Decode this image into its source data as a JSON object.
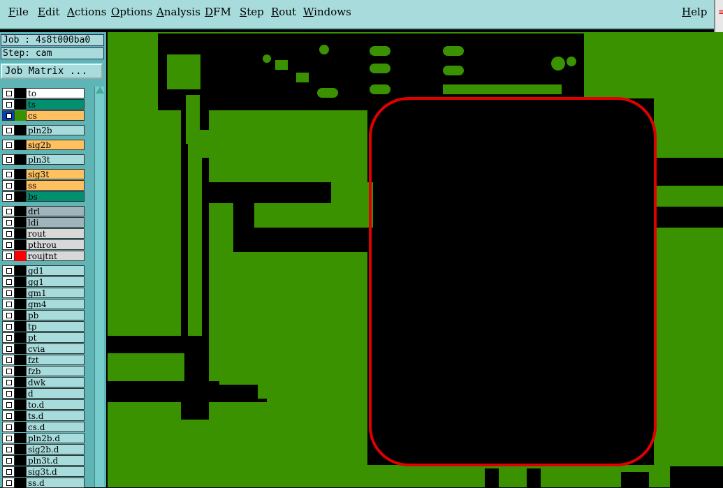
{
  "menubar": {
    "items": [
      "File",
      "Edit",
      "Actions",
      "Options",
      "Analysis",
      "DFM",
      "Step",
      "Rout",
      "Windows"
    ],
    "help": "Help"
  },
  "panel": {
    "job": "Job : 4s8t000ba0",
    "step": "Step: cam",
    "job_matrix": "Job Matrix ..."
  },
  "layers": [
    {
      "name": "to",
      "color": "#ffffff",
      "swatch": "#000000"
    },
    {
      "name": "ts",
      "color": "#009070",
      "swatch": "#000000"
    },
    {
      "name": "cs",
      "color": "#ffc060",
      "swatch": "#3a9200",
      "active": true
    },
    {
      "name": "pln2b",
      "color": "#a8dcdc",
      "swatch": "#000000"
    },
    {
      "name": "sig2b",
      "color": "#ffc060",
      "swatch": "#000000"
    },
    {
      "name": "pln3t",
      "color": "#a8dcdc",
      "swatch": "#000000"
    },
    {
      "name": "sig3t",
      "color": "#ffc060",
      "swatch": "#000000"
    },
    {
      "name": "ss",
      "color": "#ffc060",
      "swatch": "#000000"
    },
    {
      "name": "bs",
      "color": "#009070",
      "swatch": "#000000"
    },
    {
      "name": "drl",
      "color": "#a0b4bc",
      "swatch": "#000000"
    },
    {
      "name": "ldi",
      "color": "#a0b4bc",
      "swatch": "#000000"
    },
    {
      "name": "rout",
      "color": "#d8d8d8",
      "swatch": "#000000"
    },
    {
      "name": "pthrou",
      "color": "#d8d8d8",
      "swatch": "#000000"
    },
    {
      "name": "roujtnt",
      "color": "#d8d8d8",
      "swatch": "#ff0000"
    },
    {
      "name": "gd1",
      "color": "#a8dcdc",
      "swatch": "#000000"
    },
    {
      "name": "gg1",
      "color": "#a8dcdc",
      "swatch": "#000000"
    },
    {
      "name": "gm1",
      "color": "#a8dcdc",
      "swatch": "#000000"
    },
    {
      "name": "gm4",
      "color": "#a8dcdc",
      "swatch": "#000000"
    },
    {
      "name": "pb",
      "color": "#a8dcdc",
      "swatch": "#000000"
    },
    {
      "name": "tp",
      "color": "#a8dcdc",
      "swatch": "#000000"
    },
    {
      "name": "pt",
      "color": "#a8dcdc",
      "swatch": "#000000"
    },
    {
      "name": "cvia",
      "color": "#a8dcdc",
      "swatch": "#000000"
    },
    {
      "name": "fzt",
      "color": "#a8dcdc",
      "swatch": "#000000"
    },
    {
      "name": "fzb",
      "color": "#a8dcdc",
      "swatch": "#000000"
    },
    {
      "name": "dwk",
      "color": "#a8dcdc",
      "swatch": "#000000"
    },
    {
      "name": "d",
      "color": "#a8dcdc",
      "swatch": "#000000"
    },
    {
      "name": "to.d",
      "color": "#a8dcdc",
      "swatch": "#000000"
    },
    {
      "name": "ts.d",
      "color": "#a8dcdc",
      "swatch": "#000000"
    },
    {
      "name": "cs.d",
      "color": "#a8dcdc",
      "swatch": "#000000"
    },
    {
      "name": "pln2b.d",
      "color": "#a8dcdc",
      "swatch": "#000000"
    },
    {
      "name": "sig2b.d",
      "color": "#a8dcdc",
      "swatch": "#000000"
    },
    {
      "name": "pln3t.d",
      "color": "#a8dcdc",
      "swatch": "#000000"
    },
    {
      "name": "sig3t.d",
      "color": "#a8dcdc",
      "swatch": "#000000"
    },
    {
      "name": "ss.d",
      "color": "#a8dcdc",
      "swatch": "#000000"
    }
  ],
  "colors": {
    "board": "#3a9200",
    "copper_gap": "#000000",
    "rout_outline": "#e00000"
  }
}
